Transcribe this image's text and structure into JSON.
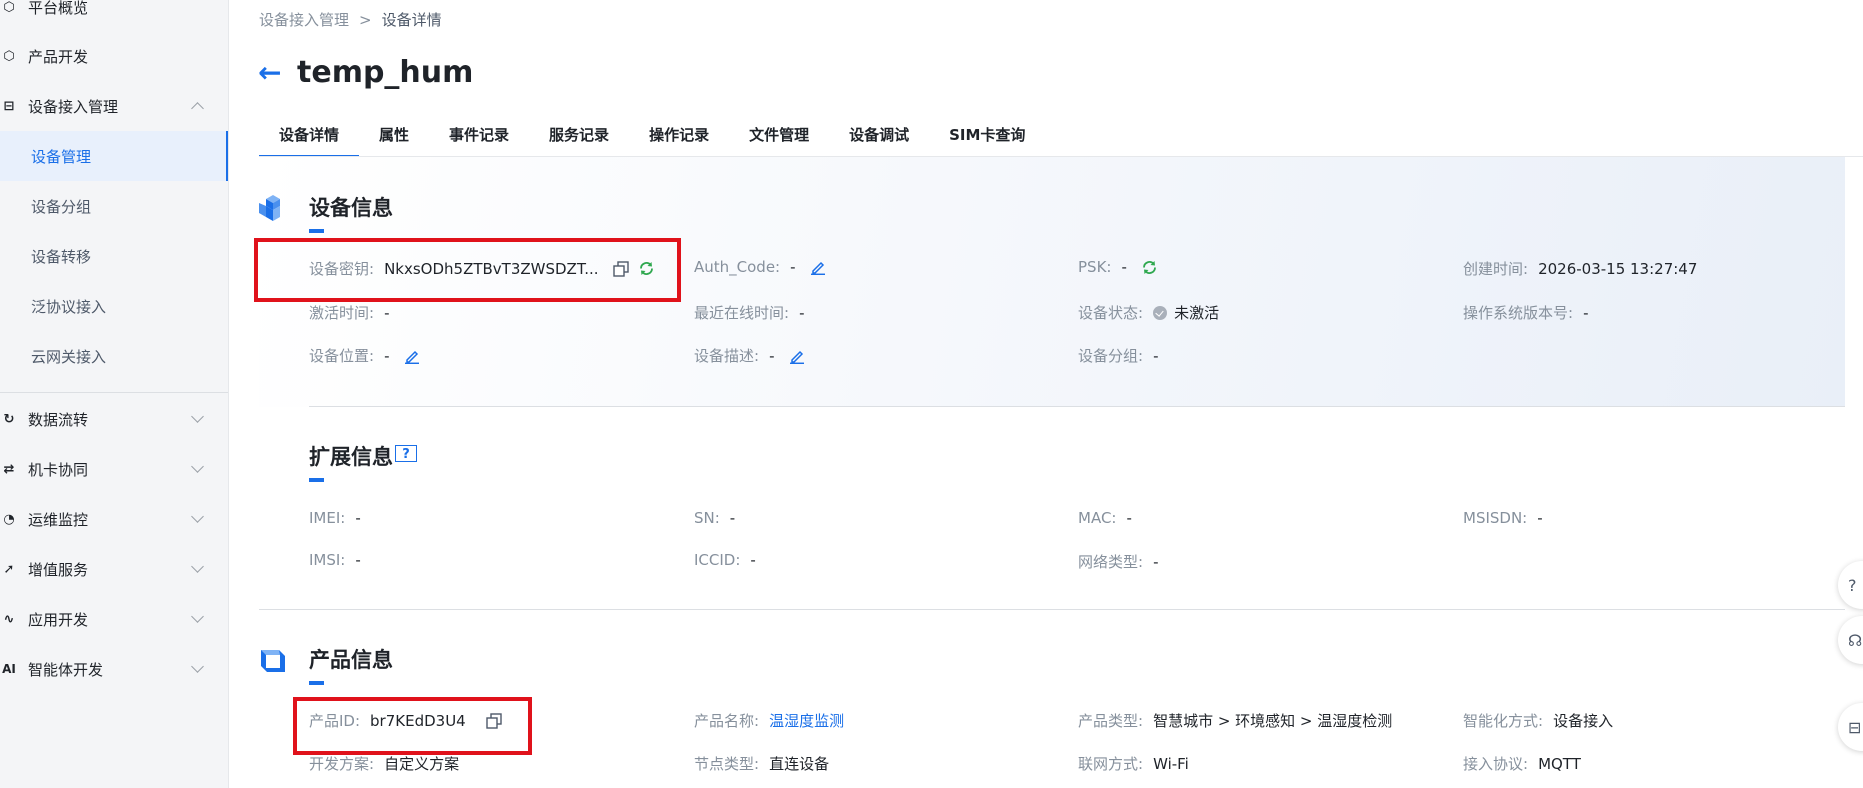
{
  "sidebar": {
    "items": [
      {
        "label": "平台概览",
        "icon": "overview-icon"
      },
      {
        "label": "产品开发",
        "icon": "product-cube-icon"
      },
      {
        "label": "设备接入管理",
        "icon": "device-access-icon",
        "expanded": true
      },
      {
        "label": "数据流转",
        "icon": "data-flow-icon"
      },
      {
        "label": "机卡协同",
        "icon": "card-sync-icon"
      },
      {
        "label": "运维监控",
        "icon": "monitor-icon"
      },
      {
        "label": "增值服务",
        "icon": "value-added-icon"
      },
      {
        "label": "应用开发",
        "icon": "app-dev-icon"
      },
      {
        "label": "智能体开发",
        "icon": "AI"
      }
    ],
    "sub_items": [
      {
        "label": "设备管理",
        "active": true
      },
      {
        "label": "设备分组"
      },
      {
        "label": "设备转移"
      },
      {
        "label": "泛协议接入"
      },
      {
        "label": "云网关接入"
      }
    ]
  },
  "breadcrumb": {
    "parent": "设备接入管理",
    "separator": ">",
    "current": "设备详情"
  },
  "page_title": "temp_hum",
  "tabs": [
    "设备详情",
    "属性",
    "事件记录",
    "服务记录",
    "操作记录",
    "文件管理",
    "设备调试",
    "SIM卡查询"
  ],
  "device_info": {
    "title": "设备信息",
    "device_key": {
      "label": "设备密钥:",
      "value": "NkxsODh5ZTBvT3ZWSDZT..."
    },
    "auth_code": {
      "label": "Auth_Code:",
      "value": "-"
    },
    "psk": {
      "label": "PSK:",
      "value": "-"
    },
    "created": {
      "label": "创建时间:",
      "value": "2026-03-15 13:27:47"
    },
    "activated": {
      "label": "激活时间:",
      "value": "-"
    },
    "last_online": {
      "label": "最近在线时间:",
      "value": "-"
    },
    "status": {
      "label": "设备状态:",
      "value": "未激活"
    },
    "os_version": {
      "label": "操作系统版本号:",
      "value": "-"
    },
    "location": {
      "label": "设备位置:",
      "value": "-"
    },
    "description": {
      "label": "设备描述:",
      "value": "-"
    },
    "group": {
      "label": "设备分组:",
      "value": "-"
    }
  },
  "ext_info": {
    "title": "扩展信息",
    "help": "?",
    "imei": {
      "label": "IMEI:",
      "value": "-"
    },
    "sn": {
      "label": "SN:",
      "value": "-"
    },
    "mac": {
      "label": "MAC:",
      "value": "-"
    },
    "msisdn": {
      "label": "MSISDN:",
      "value": "-"
    },
    "imsi": {
      "label": "IMSI:",
      "value": "-"
    },
    "iccid": {
      "label": "ICCID:",
      "value": "-"
    },
    "net_type": {
      "label": "网络类型:",
      "value": "-"
    }
  },
  "product_info": {
    "title": "产品信息",
    "product_id": {
      "label": "产品ID:",
      "value": "br7KEdD3U4"
    },
    "product_name": {
      "label": "产品名称:",
      "value": "温湿度监测"
    },
    "product_type": {
      "label": "产品类型:",
      "value": "智慧城市 > 环境感知 > 温湿度检测"
    },
    "smart_mode": {
      "label": "智能化方式:",
      "value": "设备接入"
    },
    "dev_plan": {
      "label": "开发方案:",
      "value": "自定义方案"
    },
    "node_type": {
      "label": "节点类型:",
      "value": "直连设备"
    },
    "network": {
      "label": "联网方式:",
      "value": "Wi-Fi"
    },
    "protocol": {
      "label": "接入协议:",
      "value": "MQTT"
    }
  },
  "colors": {
    "accent": "#1a6fe8",
    "highlight": "#e0121b",
    "refresh": "#2fa84f"
  }
}
